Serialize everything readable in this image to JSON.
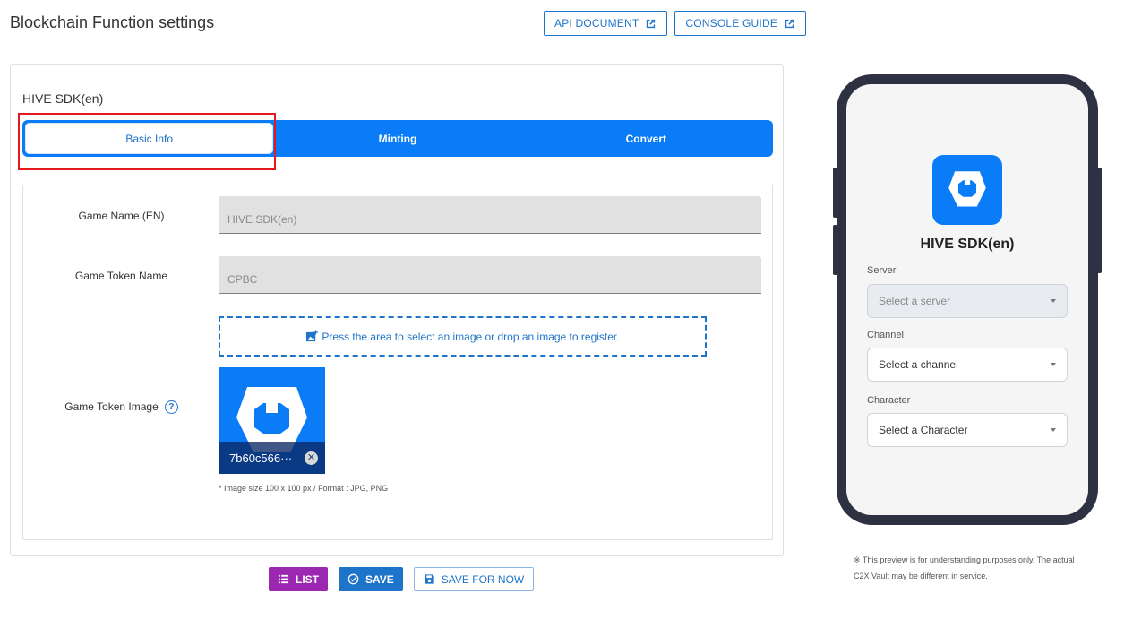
{
  "header": {
    "title": "Blockchain Function settings",
    "api_document_label": "API DOCUMENT",
    "console_guide_label": "CONSOLE GUIDE"
  },
  "panel": {
    "section_title": "HIVE SDK(en)"
  },
  "tabs": [
    {
      "label": "Basic Info",
      "active": true
    },
    {
      "label": "Minting",
      "active": false
    },
    {
      "label": "Convert",
      "active": false
    }
  ],
  "form": {
    "game_name": {
      "label": "Game Name (EN)",
      "value": "HIVE SDK(en)"
    },
    "token_name": {
      "label": "Game Token Name",
      "value": "CPBC"
    },
    "token_image": {
      "label": "Game Token Image",
      "help_glyph": "?",
      "upload_text": "Press the area to select an image or drop an image to register.",
      "file_name": "7b60c566···",
      "remove_glyph": "✕",
      "size_note": "* Image size 100 x 100 px / Format : JPG, PNG"
    }
  },
  "actions": {
    "list_label": "LIST",
    "save_label": "SAVE",
    "save_for_now_label": "SAVE FOR NOW"
  },
  "preview": {
    "app_name": "HIVE SDK(en)",
    "server_label": "Server",
    "server_placeholder": "Select a server",
    "channel_label": "Channel",
    "channel_placeholder": "Select a channel",
    "character_label": "Character",
    "character_placeholder": "Select a Character",
    "note": "※ This preview is for understanding purposes only. The actual C2X Vault may be different in service."
  },
  "colors": {
    "primary": "#1e74c9",
    "tab_blue": "#0a7cf7",
    "list_purple": "#9c27b0",
    "highlight_red": "#e5191d",
    "phone_frame": "#2e3142"
  },
  "icons": [
    "external-link-icon",
    "add-photo-icon",
    "help-icon",
    "close-circle-icon",
    "list-icon",
    "check-circle-icon",
    "floppy-icon",
    "shield-logo-icon",
    "chevron-down-icon"
  ]
}
